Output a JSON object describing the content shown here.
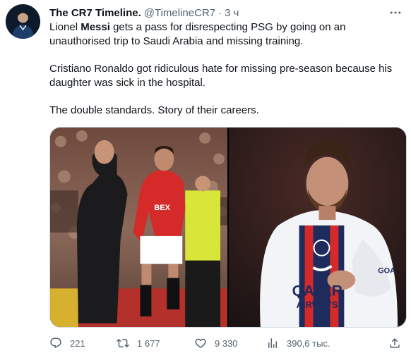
{
  "author": {
    "display_name": "The CR7 Timeline.",
    "handle": "@TimelineCR7",
    "separator": "·",
    "time": "3 ч"
  },
  "tweet": {
    "p1_start": "Lionel ",
    "p1_bold": "Messi",
    "p1_end": " gets a pass for disrespecting PSG by going on an unauthorised trip to Saudi Arabia and missing training.",
    "p2": "Cristiano Ronaldo got ridiculous hate for missing pre-season because his daughter was sick in the hospital.",
    "p3": "The double standards. Story of their careers."
  },
  "media": {
    "left_shirt_text": "BEX",
    "right_shirt_text_1": "QATAR",
    "right_shirt_text_2": "AIRWAYS",
    "right_sleeve_text": "GOA"
  },
  "actions": {
    "replies": "221",
    "retweets": "1 677",
    "likes": "9 330",
    "views": "390,6 тыс."
  },
  "icons": {
    "more": "more-horizontal-icon",
    "reply": "reply-icon",
    "retweet": "retweet-icon",
    "like": "heart-icon",
    "views": "views-icon",
    "share": "share-icon"
  },
  "colors": {
    "text": "#0f1419",
    "secondary": "#536471",
    "border": "#cfd9de",
    "united_red": "#d42a2a",
    "psg_navy": "#1e2b5c"
  }
}
